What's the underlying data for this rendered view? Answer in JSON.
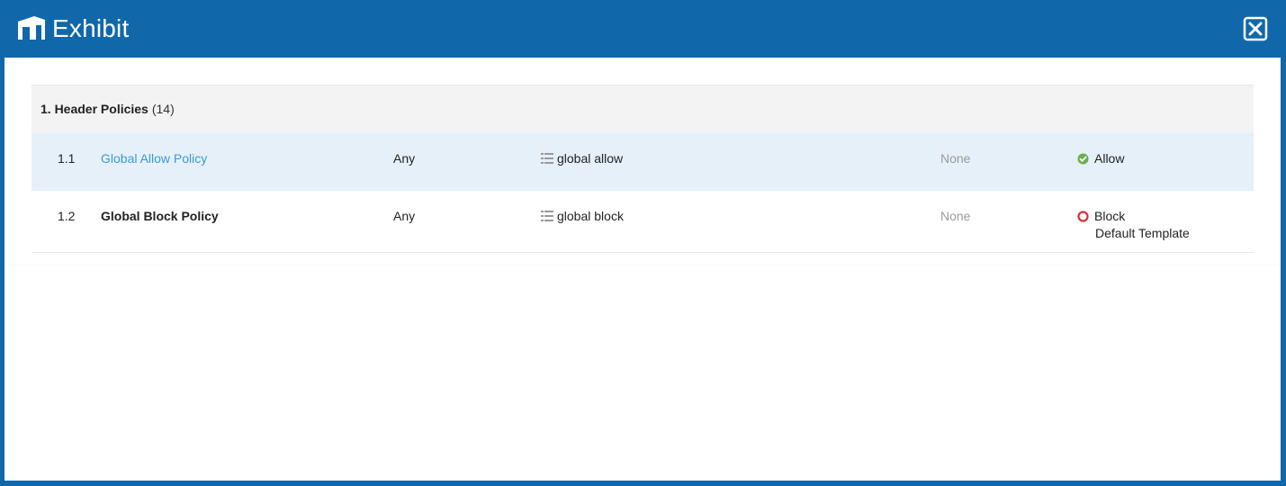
{
  "window": {
    "title": "Exhibit",
    "icon": "exhibit-icon",
    "close_icon": "close-icon"
  },
  "section": {
    "title": "1. Header Policies",
    "count": "(14)"
  },
  "rows": [
    {
      "number": "1.1",
      "name": "Global Allow Policy",
      "source": "Any",
      "list_icon": "list-icon",
      "list_name": "global allow",
      "extra": "None",
      "action_icon": "allow-check-icon",
      "action": "Allow",
      "action_detail": ""
    },
    {
      "number": "1.2",
      "name": "Global Block Policy",
      "source": "Any",
      "list_icon": "list-icon",
      "list_name": "global block",
      "extra": "None",
      "action_icon": "block-circle-icon",
      "action": "Block",
      "action_detail": "Default Template"
    }
  ],
  "colors": {
    "titlebar": "#1068aa",
    "link": "#3a9bd4",
    "selected_row": "#e6f0f8",
    "allow": "#6ab04c",
    "block": "#d9303a"
  }
}
